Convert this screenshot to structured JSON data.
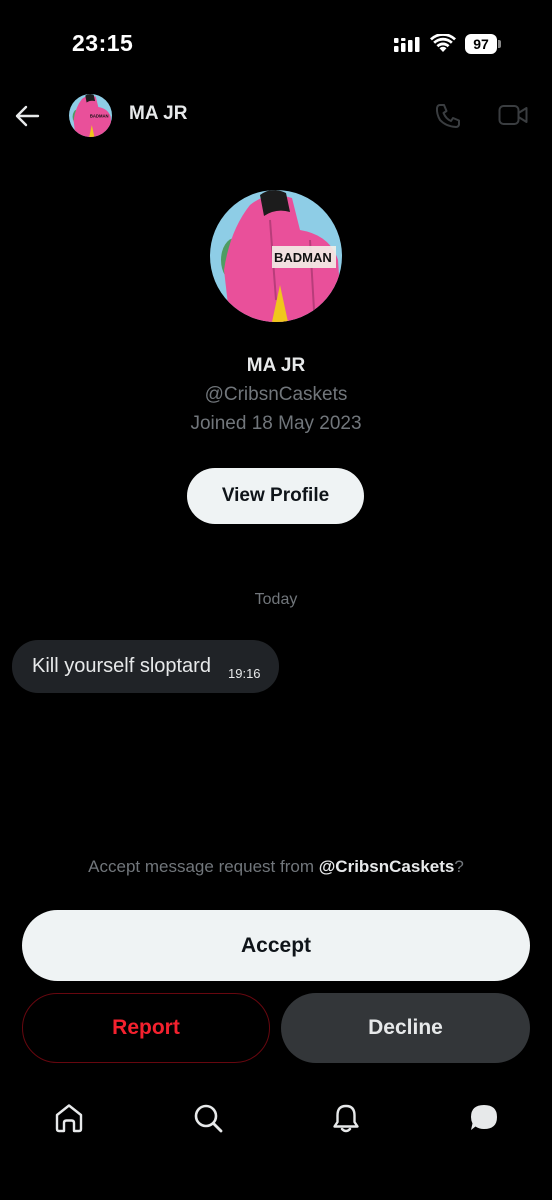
{
  "status_bar": {
    "time": "23:15",
    "battery": "97"
  },
  "header": {
    "name": "MA JR"
  },
  "profile": {
    "name": "MA JR",
    "handle": "@CribsnCaskets",
    "joined": "Joined 18 May 2023",
    "view_profile_label": "View Profile",
    "shirt_text": "BADMAN"
  },
  "conversation": {
    "date_separator": "Today",
    "messages": [
      {
        "text": "Kill yourself sloptard",
        "time": "19:16"
      }
    ]
  },
  "request": {
    "prefix": "Accept message request from ",
    "handle": "@CribsnCaskets",
    "suffix": "?",
    "accept_label": "Accept",
    "report_label": "Report",
    "decline_label": "Decline"
  },
  "colors": {
    "background": "#000000",
    "text_primary": "#e7e9ea",
    "text_secondary": "#71767b",
    "report_red": "#f4212e",
    "bubble": "#202327"
  },
  "bottom_nav": [
    "home-icon",
    "search-icon",
    "notifications-icon",
    "messages-icon"
  ]
}
